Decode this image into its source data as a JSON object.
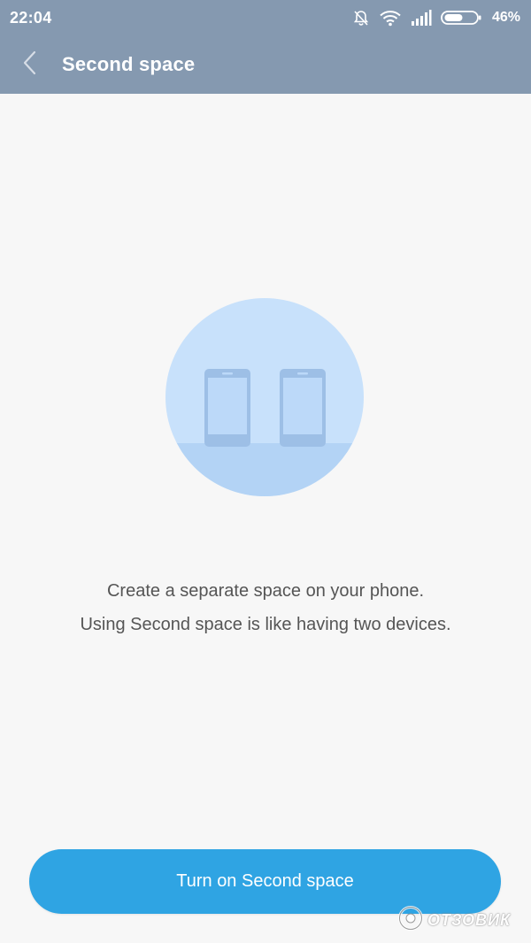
{
  "status_bar": {
    "time": "22:04",
    "battery_percent": "46%",
    "icons": [
      "notifications-off-icon",
      "wifi-icon",
      "signal-icon",
      "battery-icon"
    ]
  },
  "header": {
    "back_icon": "chevron-left-icon",
    "title": "Second space"
  },
  "illustration": {
    "icon": "two-phones-icon"
  },
  "description": {
    "line1": "Create a separate space on your phone.",
    "line2": "Using Second space is like having two devices."
  },
  "actions": {
    "turn_on_label": "Turn on Second space"
  },
  "watermark": {
    "text": "ОТЗОВИК"
  },
  "colors": {
    "header_bg": "#8599b0",
    "page_bg": "#f7f7f7",
    "button_bg": "#2fa4e3",
    "illustration_circle": "#c8e1fb",
    "illustration_floor": "#b3d3f5",
    "phone_body": "#9dbfe6"
  }
}
